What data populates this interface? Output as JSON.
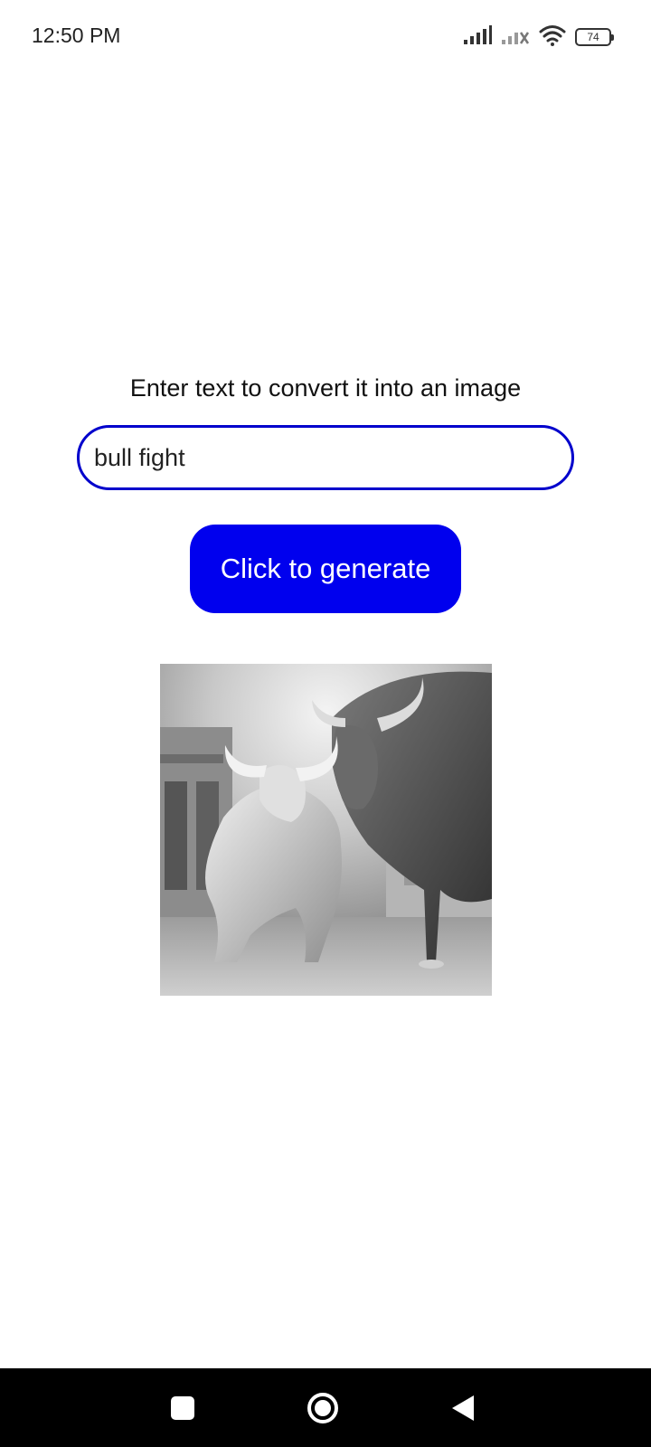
{
  "status_bar": {
    "time": "12:50 PM",
    "battery_level": "74",
    "icons": [
      "signal-icon",
      "signal-no-sim-icon",
      "wifi-icon",
      "battery-icon"
    ]
  },
  "main": {
    "prompt_label": "Enter text to convert it into an image",
    "input_value": "bull fight",
    "generate_button_label": "Click to generate",
    "generated_image_desc": "generated-image"
  },
  "colors": {
    "accent": "#0000ee",
    "input_border": "#0000cc",
    "nav_bar": "#000000"
  },
  "nav_bar": {
    "icons": [
      "recents-icon",
      "home-icon",
      "back-icon"
    ]
  }
}
